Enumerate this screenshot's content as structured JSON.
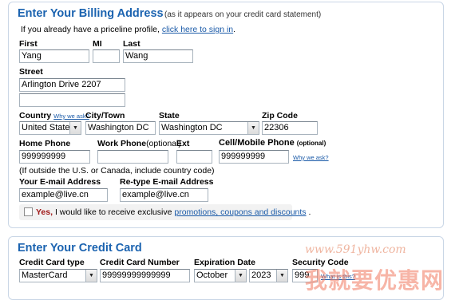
{
  "billing": {
    "title": "Enter Your Billing Address",
    "subtitle": "(as it appears on your credit card statement)",
    "signin_prefix": "If you already have a priceline profile,",
    "signin_link": "click here to sign in",
    "signin_suffix": ".",
    "first_label": "First",
    "first_value": "Yang",
    "mi_label": "MI",
    "mi_value": "",
    "last_label": "Last",
    "last_value": "Wang",
    "street_label": "Street",
    "street1_value": "Arlington Drive 2207",
    "street2_value": "",
    "country_label": "Country",
    "country_why": "Why we ask?",
    "country_value": "United States",
    "city_label": "City/Town",
    "city_value": "Washington DC",
    "state_label": "State",
    "state_value": "Washington DC",
    "zip_label": "Zip Code",
    "zip_value": "22306",
    "home_phone_label": "Home Phone",
    "home_phone_value": "999999999",
    "work_phone_label": "Work Phone",
    "work_phone_optional": "(optional)",
    "work_phone_value": "",
    "ext_label": "Ext",
    "ext_value": "",
    "cell_label": "Cell/Mobile Phone",
    "cell_optional": "(optional)",
    "cell_value": "999999999",
    "cell_why": "Why we ask?",
    "intl_note": "(If outside the U.S. or Canada, include country code)",
    "email_label": "Your E-mail Address",
    "email_value": "example@live.cn",
    "retype_email_label": "Re-type E-mail Address",
    "retype_email_value": "example@live.cn",
    "promo_yes": "Yes,",
    "promo_text": "I would like to receive exclusive",
    "promo_link": "promotions, coupons and discounts",
    "promo_suffix": "."
  },
  "credit_card": {
    "title": "Enter Your Credit Card",
    "type_label": "Credit Card type",
    "type_value": "MasterCard",
    "number_label": "Credit Card Number",
    "number_value": "99999999999999",
    "expiration_label": "Expiration Date",
    "exp_month_value": "October",
    "exp_year_value": "2023",
    "security_label": "Security Code",
    "security_value": "999",
    "security_link": "What is this?"
  },
  "watermark": {
    "url": "www.591yhw.com",
    "text": "我就要优惠网"
  },
  "colors": {
    "heading": "#1b63b0",
    "link": "#1a5aa8",
    "yes": "#a01818",
    "border": "#c9d6e6"
  }
}
